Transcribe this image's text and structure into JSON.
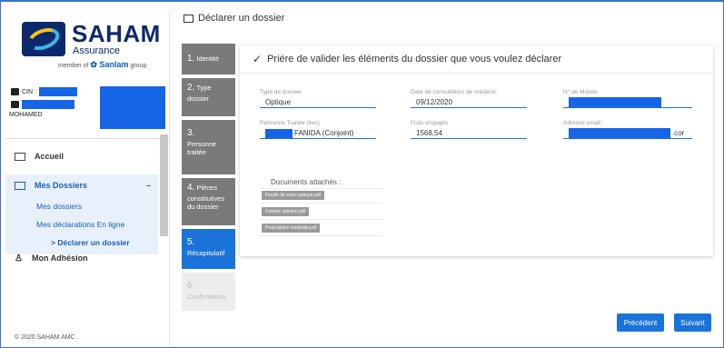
{
  "brand": {
    "name": "SAHAM",
    "subtitle": "Assurance",
    "tagline_prefix": "member of",
    "tagline_brand": "Sanlam",
    "tagline_suffix": "group"
  },
  "user": {
    "cin_label": "CIN :",
    "name_line": "MOHAMED"
  },
  "nav": {
    "home": "Accueil",
    "dossiers": "Mes Dossiers",
    "dossiers_toggle": "–",
    "sub": [
      "Mes dossiers",
      "Mes déclarations En ligne",
      "Déclarer un dossier"
    ],
    "sub_current_prefix": ">",
    "adhesion": "Mon Adhésion"
  },
  "footer": "© 2020 SAHAM AMC .",
  "page": {
    "title": "Déclarer un dossier"
  },
  "steps": [
    {
      "num": "1.",
      "label": "Identité"
    },
    {
      "num": "2.",
      "label": "Type dossier"
    },
    {
      "num": "3.",
      "label": "Personne traitée"
    },
    {
      "num": "4.",
      "label": "Pièces constitutives du dossier"
    },
    {
      "num": "5.",
      "label": "Récapitulatif"
    },
    {
      "num": "6.",
      "label": "Confirmation"
    }
  ],
  "panel": {
    "heading": "Priére de valider les éléments du dossier que vous voulez déclarer",
    "fields": {
      "type_label": "Type de dossier",
      "type_value": "Optique",
      "date_label": "Date de consultation de médecin",
      "date_value": "09/12/2020",
      "mobile_label": "N° de Mobile",
      "person_label": "Personne Traitée (lien)",
      "person_value": "FANIDA (Conjoint)",
      "fees_label": "Frais engagés",
      "fees_value": "1568,54",
      "email_label": "Adresse email :",
      "email_suffix": ".cor"
    },
    "docs_label": "Documents attachés :",
    "documents": [
      "Feuille de soins optique.pdf",
      "Facture opticien.pdf",
      "Prescription médicale.pdf"
    ]
  },
  "buttons": {
    "prev": "Précédent",
    "next": "Suivant"
  },
  "colors": {
    "primary": "#1a73d9",
    "brand_navy": "#0c2a6b",
    "redaction": "#1565e6"
  }
}
